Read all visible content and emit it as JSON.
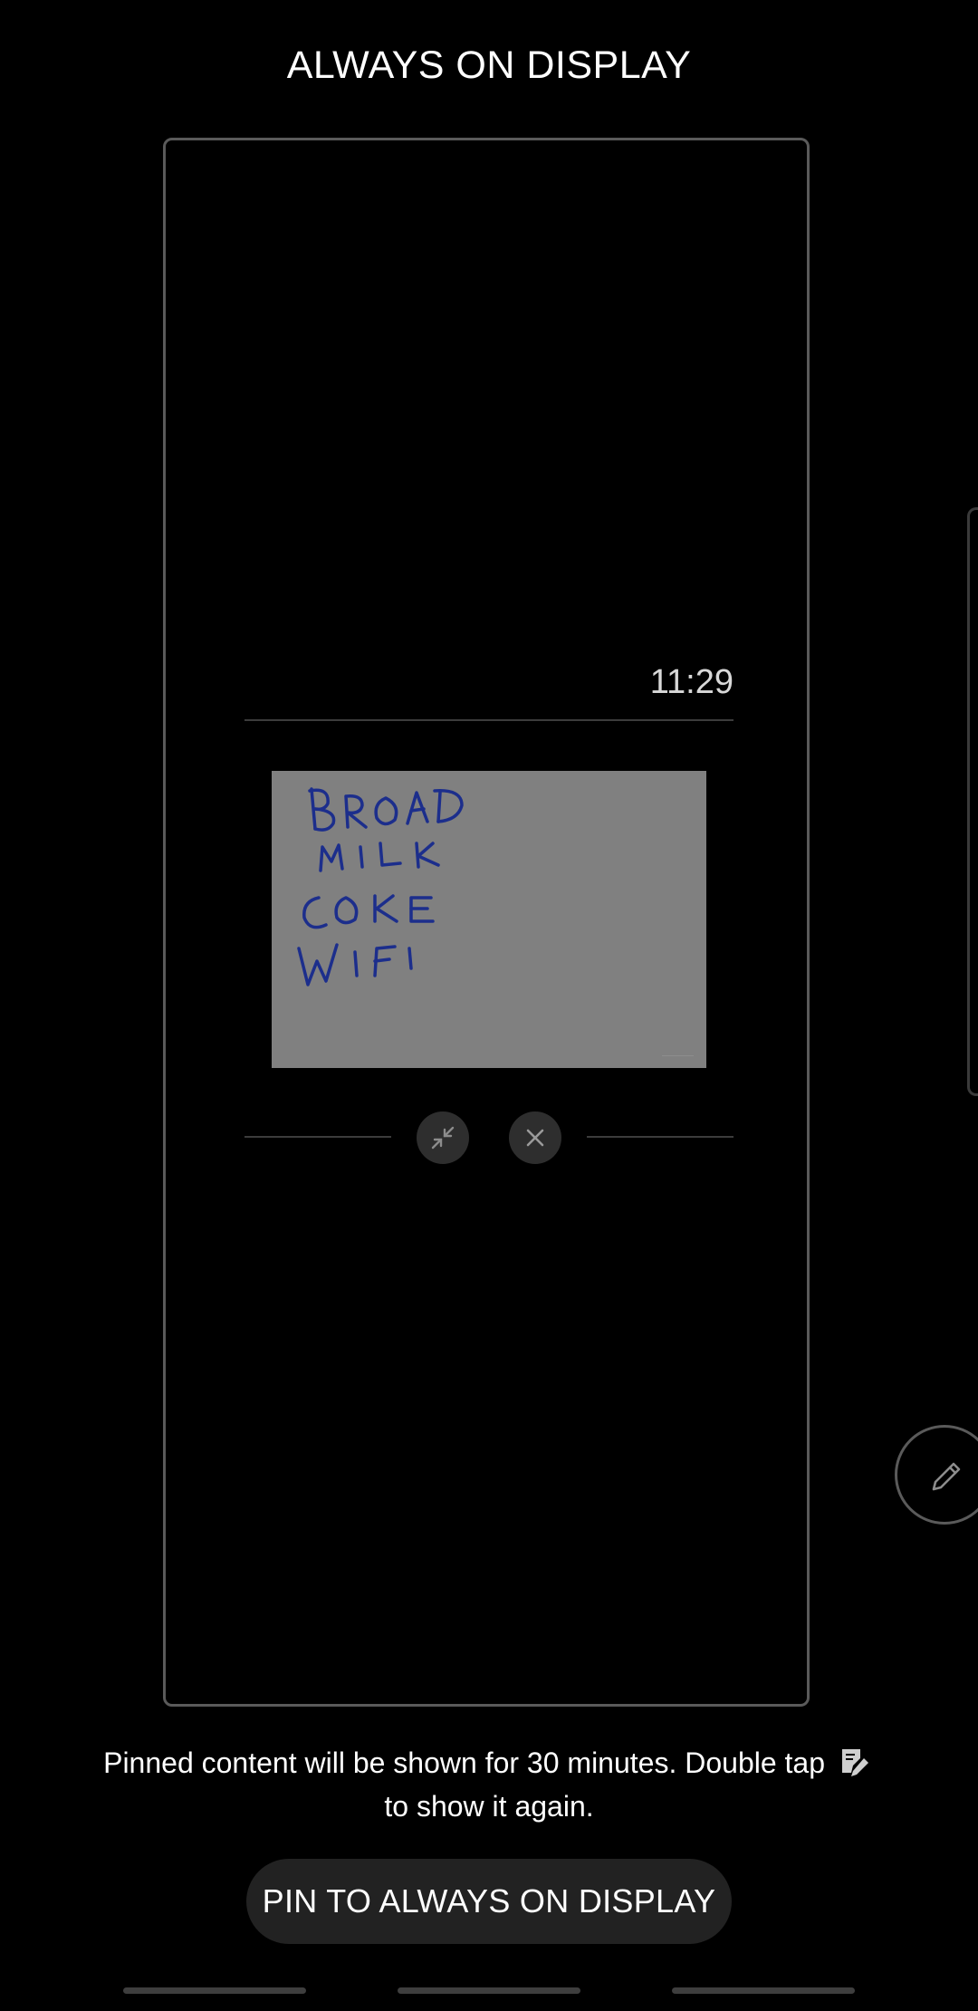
{
  "header": {
    "title": "ALWAYS ON DISPLAY"
  },
  "preview": {
    "clock": "11:29",
    "memo_lines": [
      "BROAD",
      "MILK",
      "COKE",
      "WIFI"
    ]
  },
  "controls": {
    "minimize_icon": "minimize-icon",
    "close_icon": "close-icon",
    "pen_icon": "pen-icon"
  },
  "info": {
    "before_icon": "Pinned content will be shown for 30 minutes. Double tap",
    "after_icon": "to show it again.",
    "inline_icon": "screen-write-icon"
  },
  "actions": {
    "pin_label": "PIN TO ALWAYS ON DISPLAY"
  },
  "colors": {
    "background": "#000000",
    "ink": "#1c2e8c",
    "memo_paper": "#808080",
    "button_bg": "#222222"
  }
}
